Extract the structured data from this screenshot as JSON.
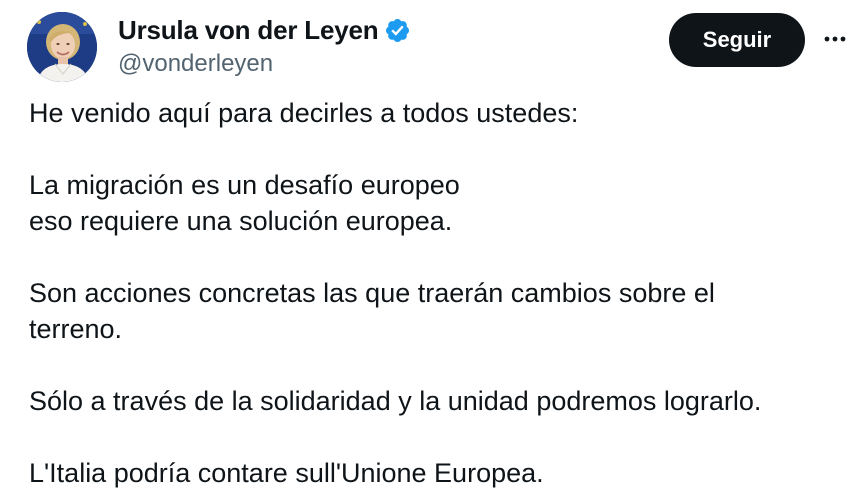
{
  "author": {
    "display_name": "Ursula von der Leyen",
    "handle": "@vonderleyen",
    "verified": true,
    "verified_icon": "verified-badge-icon",
    "verified_color": "#1d9bf0",
    "avatar_icon": "profile-photo-avatar"
  },
  "actions": {
    "follow_label": "Seguir",
    "more_icon": "more-options-icon"
  },
  "tweet": {
    "paragraphs": [
      [
        "He venido aquí para decirles a todos ustedes:"
      ],
      [
        "La migración es un desafío europeo",
        "eso requiere una solución europea."
      ],
      [
        "Son acciones concretas las que traerán cambios sobre el",
        "terreno."
      ],
      [
        "Sólo a través de la solidaridad y la unidad podremos lograrlo."
      ],
      [
        "L'Italia podría contare sull'Unione Europea."
      ]
    ]
  },
  "colors": {
    "text": "#0f1419",
    "secondary_text": "#536471",
    "button_bg": "#0f1419",
    "button_text": "#ffffff"
  }
}
